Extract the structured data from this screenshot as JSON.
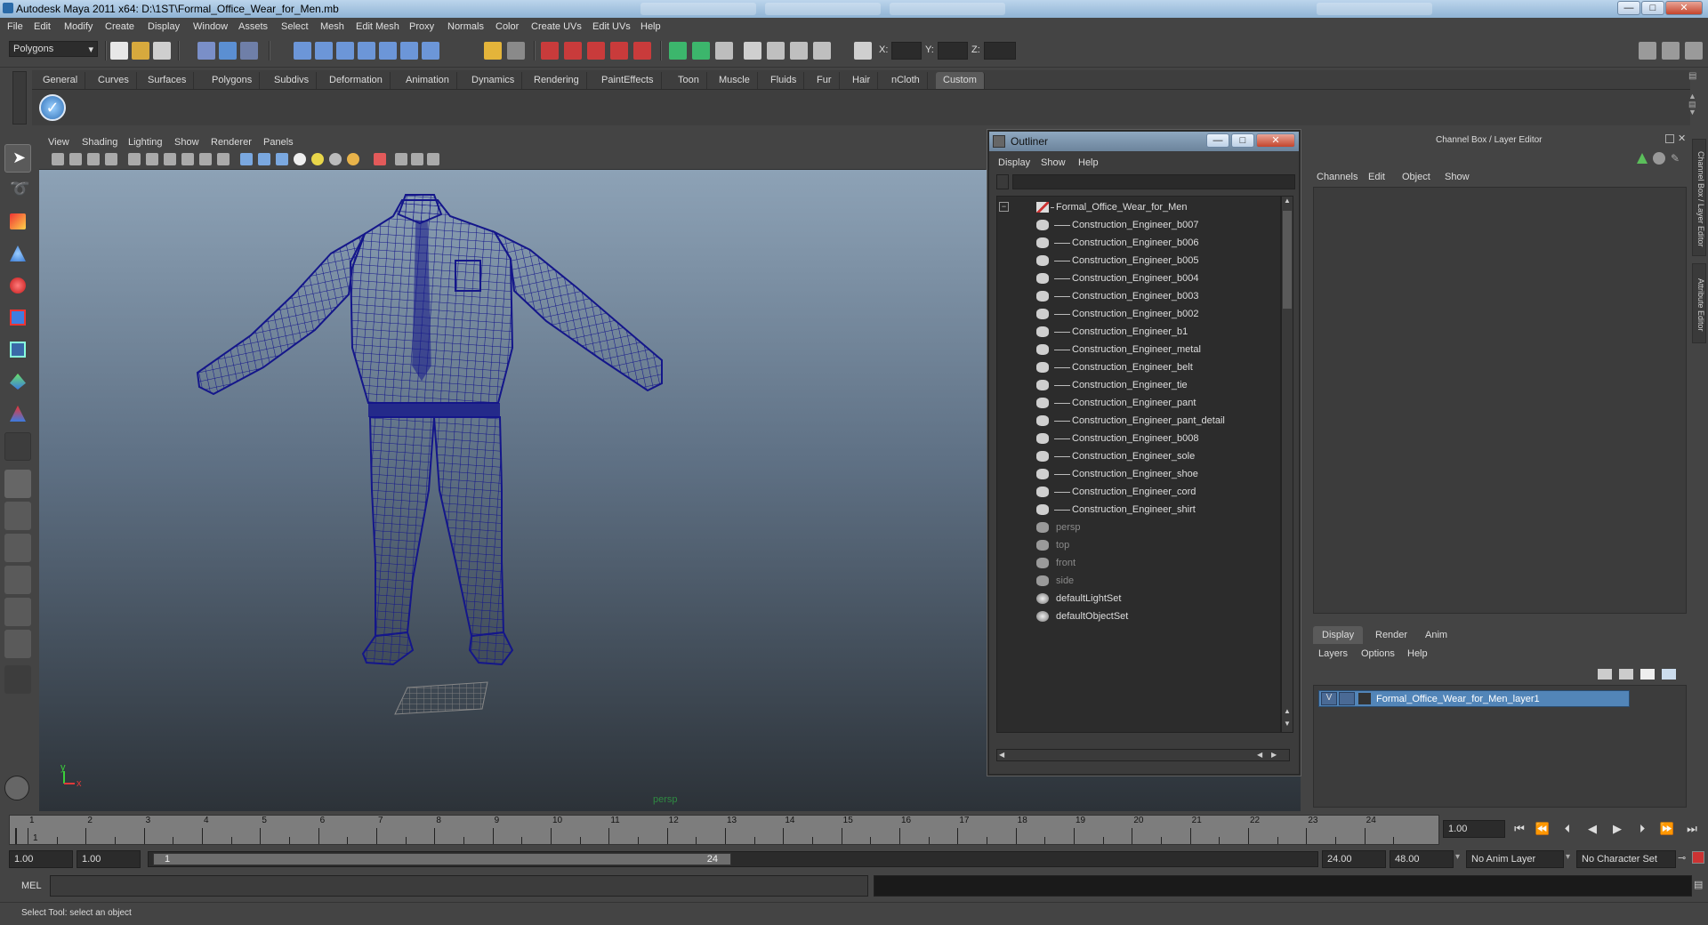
{
  "window": {
    "title": "Autodesk Maya 2011 x64: D:\\1ST\\Formal_Office_Wear_for_Men.mb",
    "minimize": "—",
    "maximize": "□",
    "close": "✕"
  },
  "menubar": [
    "File",
    "Edit",
    "Modify",
    "Create",
    "Display",
    "Window",
    "Assets",
    "Select",
    "Mesh",
    "Edit Mesh",
    "Proxy",
    "Normals",
    "Color",
    "Create UVs",
    "Edit UVs",
    "Help"
  ],
  "statusline": {
    "mode": "Polygons",
    "x_label": "X:",
    "y_label": "Y:",
    "z_label": "Z:"
  },
  "shelf": {
    "tabs": [
      "General",
      "Curves",
      "Surfaces",
      "Polygons",
      "Subdivs",
      "Deformation",
      "Animation",
      "Dynamics",
      "Rendering",
      "PaintEffects",
      "Toon",
      "Muscle",
      "Fluids",
      "Fur",
      "Hair",
      "nCloth",
      "Custom"
    ],
    "active": "Custom"
  },
  "viewport": {
    "menu": [
      "View",
      "Shading",
      "Lighting",
      "Show",
      "Renderer",
      "Panels"
    ],
    "camera_label": "persp",
    "axis_y": "y",
    "axis_x": "x"
  },
  "outliner": {
    "title": "Outliner",
    "menu": [
      "Display",
      "Show",
      "Help"
    ],
    "root": "Formal_Office_Wear_for_Men",
    "children": [
      "Construction_Engineer_b007",
      "Construction_Engineer_b006",
      "Construction_Engineer_b005",
      "Construction_Engineer_b004",
      "Construction_Engineer_b003",
      "Construction_Engineer_b002",
      "Construction_Engineer_b1",
      "Construction_Engineer_metal",
      "Construction_Engineer_belt",
      "Construction_Engineer_tie",
      "Construction_Engineer_pant",
      "Construction_Engineer_pant_detail",
      "Construction_Engineer_b008",
      "Construction_Engineer_sole",
      "Construction_Engineer_shoe",
      "Construction_Engineer_cord",
      "Construction_Engineer_shirt"
    ],
    "cameras": [
      "persp",
      "top",
      "front",
      "side"
    ],
    "sets": [
      "defaultLightSet",
      "defaultObjectSet"
    ]
  },
  "channel_box": {
    "header": "Channel Box / Layer Editor",
    "menu": [
      "Channels",
      "Edit",
      "Object",
      "Show"
    ],
    "side_tabs": [
      "Channel Box / Layer Editor",
      "Attribute Editor"
    ]
  },
  "layer_editor": {
    "tabs": [
      "Display",
      "Render",
      "Anim"
    ],
    "active_tab": "Display",
    "menu": [
      "Layers",
      "Options",
      "Help"
    ],
    "layer": {
      "visible": "V",
      "name": "Formal_Office_Wear_for_Men_layer1"
    }
  },
  "time_slider": {
    "ticks": [
      "1",
      "2",
      "3",
      "4",
      "5",
      "6",
      "7",
      "8",
      "9",
      "10",
      "11",
      "12",
      "13",
      "14",
      "15",
      "16",
      "17",
      "18",
      "19",
      "20",
      "21",
      "22",
      "23",
      "24"
    ],
    "current_frame_label": "1",
    "current_time": "1.00"
  },
  "range": {
    "start_time": "1.00",
    "playback_start": "1.00",
    "handle_start": "1",
    "handle_end": "24",
    "playback_end": "24.00",
    "end_time": "48.00",
    "anim_layer": "No Anim Layer",
    "character_set": "No Character Set"
  },
  "commandline": {
    "label": "MEL"
  },
  "helpline": {
    "text": "Select Tool: select an object"
  },
  "colors": {
    "wireframe": "#14168a",
    "layer_highlight": "#5285b8",
    "title_blue": "#8fb3d4"
  }
}
